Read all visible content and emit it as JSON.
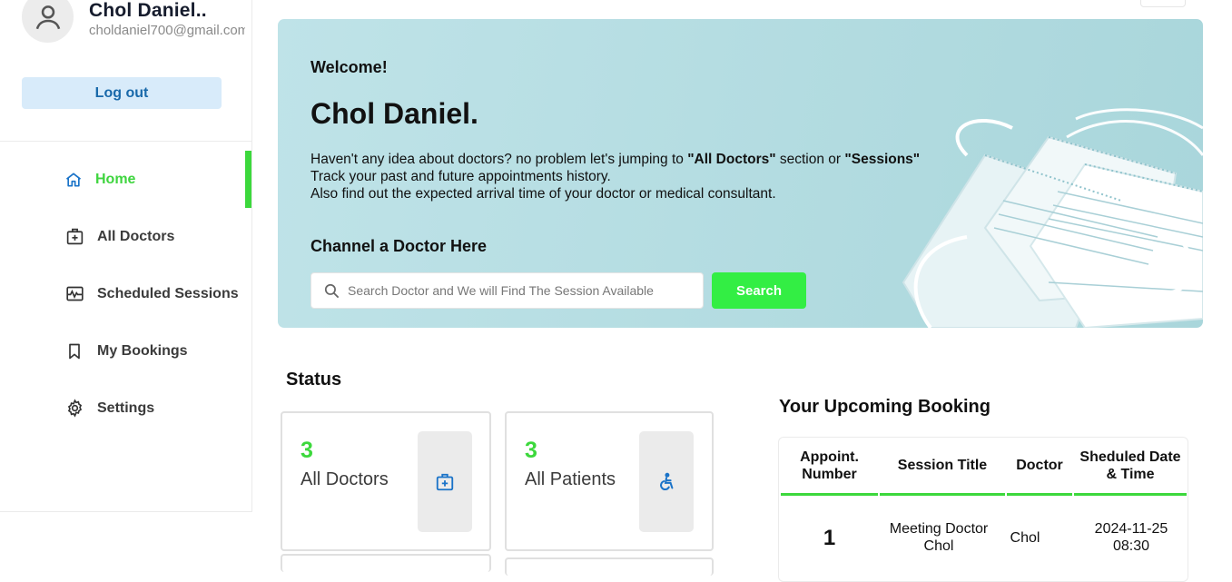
{
  "profile": {
    "name": "Chol Daniel..",
    "email": "choldaniel700@gmail.com",
    "logout_label": "Log out"
  },
  "nav": {
    "items": [
      {
        "label": "Home",
        "icon": "home-icon",
        "active": true
      },
      {
        "label": "All Doctors",
        "icon": "medical-bag-icon",
        "active": false
      },
      {
        "label": "Scheduled Sessions",
        "icon": "calendar-pulse-icon",
        "active": false
      },
      {
        "label": "My Bookings",
        "icon": "bookmark-icon",
        "active": false
      },
      {
        "label": "Settings",
        "icon": "gear-icon",
        "active": false
      }
    ]
  },
  "banner": {
    "welcome": "Welcome!",
    "name": "Chol Daniel.",
    "line1_before": "Haven't any idea about doctors? no problem let's jumping to ",
    "line1_bold1": "\"All Doctors\"",
    "line1_mid": " section or ",
    "line1_bold2": "\"Sessions\"",
    "line2": "Track your past and future appointments history.",
    "line3": "Also find out the expected arrival time of your doctor or medical consultant.",
    "channel_title": "Channel a Doctor Here",
    "search_placeholder": "Search Doctor and We will Find The Session Available",
    "search_button": "Search"
  },
  "status": {
    "title": "Status",
    "cards": [
      {
        "value": "3",
        "label": "All Doctors",
        "icon": "medical-bag-icon"
      },
      {
        "value": "3",
        "label": "All Patients",
        "icon": "wheelchair-icon"
      }
    ]
  },
  "booking": {
    "title": "Your Upcoming Booking",
    "columns": [
      "Appoint. Number",
      "Session Title",
      "Doctor",
      "Sheduled Date & Time"
    ],
    "rows": [
      {
        "number": "1",
        "session": "Meeting Doctor Chol",
        "doctor": "Chol",
        "datetime": "2024-11-25 08:30"
      }
    ]
  },
  "colors": {
    "accent_green": "#3cd83c",
    "logout_bg": "#d8ebfa",
    "logout_text": "#1969aa",
    "icon_blue": "#1a73c8",
    "banner_bg": "#b5dde2"
  }
}
